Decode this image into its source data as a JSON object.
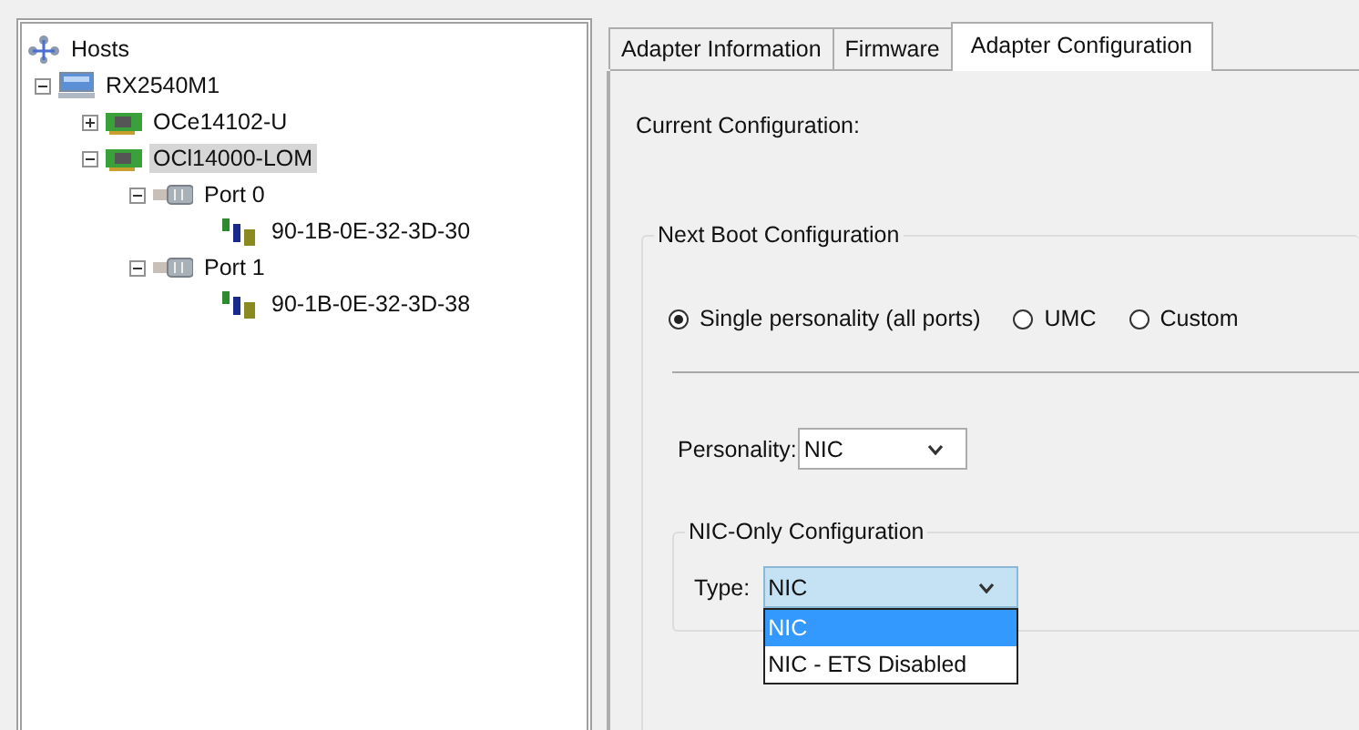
{
  "tree": [
    {
      "label": "Hosts",
      "kind": "hosts",
      "selected": false,
      "children": [
        {
          "label": "RX2540M1",
          "kind": "server",
          "expanded": true,
          "selected": false,
          "children": [
            {
              "label": "OCe14102-U",
              "kind": "adapter",
              "expanded": false,
              "selected": false
            },
            {
              "label": "OCl14000-LOM",
              "kind": "adapter",
              "expanded": true,
              "selected": true,
              "children": [
                {
                  "label": "Port 0",
                  "kind": "port",
                  "expanded": true,
                  "selected": false,
                  "children": [
                    {
                      "label": "90-1B-0E-32-3D-30",
                      "kind": "nic",
                      "selected": false
                    }
                  ]
                },
                {
                  "label": "Port 1",
                  "kind": "port",
                  "expanded": true,
                  "selected": false,
                  "children": [
                    {
                      "label": "90-1B-0E-32-3D-38",
                      "kind": "nic",
                      "selected": false
                    }
                  ]
                }
              ]
            }
          ]
        }
      ]
    }
  ],
  "tabs": [
    {
      "label": "Adapter Information",
      "selected": false
    },
    {
      "label": "Firmware",
      "selected": false
    },
    {
      "label": "Adapter Configuration",
      "selected": true
    }
  ],
  "current_configuration_label": "Current Configuration:",
  "next_boot": {
    "title": "Next Boot Configuration",
    "modes": [
      {
        "label": "Single personality (all ports)",
        "selected": true
      },
      {
        "label": "UMC",
        "selected": false
      },
      {
        "label": "Custom",
        "selected": false
      }
    ],
    "personality": {
      "label": "Personality:",
      "value": "NIC"
    },
    "nic_only": {
      "title": "NIC-Only Configuration",
      "type": {
        "label": "Type:",
        "value": "NIC",
        "expanded": true,
        "options": [
          {
            "label": "NIC",
            "selected": true
          },
          {
            "label": "NIC - ETS Disabled",
            "selected": false
          }
        ]
      }
    }
  }
}
